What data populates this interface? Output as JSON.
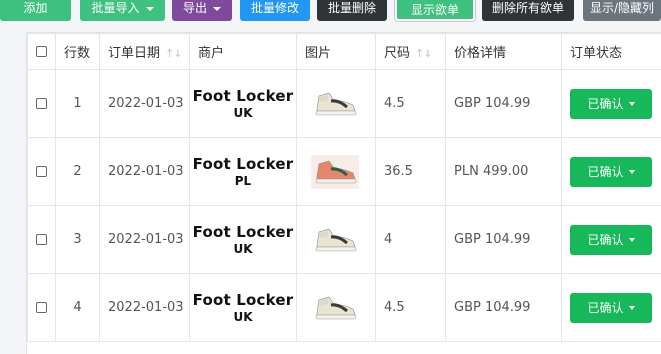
{
  "toolbar": {
    "add": "添加",
    "batch_import": "批量导入",
    "export": "导出",
    "batch_edit": "批量修改",
    "batch_delete": "批量删除",
    "show_sold": "显示欲单",
    "delete_all_sold": "删除所有欲单",
    "toggle_columns": "显示/隐藏列"
  },
  "columns": {
    "row_number": "行数",
    "order_date": "订单日期",
    "merchant": "商户",
    "image": "图片",
    "size": "尺码",
    "price": "价格详情",
    "status": "订单状态"
  },
  "sort_glyph": "↑↓",
  "rows": [
    {
      "num": "1",
      "date": "2022-01-03",
      "merchant": "Foot Locker",
      "region": "UK",
      "shoe": "sneaker-icon",
      "size": "4.5",
      "price": "GBP 104.99",
      "status": "已确认"
    },
    {
      "num": "2",
      "date": "2022-01-03",
      "merchant": "Foot Locker",
      "region": "PL",
      "shoe": "sneaker-icon",
      "size": "36.5",
      "price": "PLN 499.00",
      "status": "已确认"
    },
    {
      "num": "3",
      "date": "2022-01-03",
      "merchant": "Foot Locker",
      "region": "UK",
      "shoe": "sneaker-icon",
      "size": "4",
      "price": "GBP 104.99",
      "status": "已确认"
    },
    {
      "num": "4",
      "date": "2022-01-03",
      "merchant": "Foot Locker",
      "region": "UK",
      "shoe": "sneaker-icon",
      "size": "4.5",
      "price": "GBP 104.99",
      "status": "已确认"
    }
  ],
  "colors": {
    "confirmed": "#16b85a",
    "shoe_salmon": "#e6866a"
  }
}
